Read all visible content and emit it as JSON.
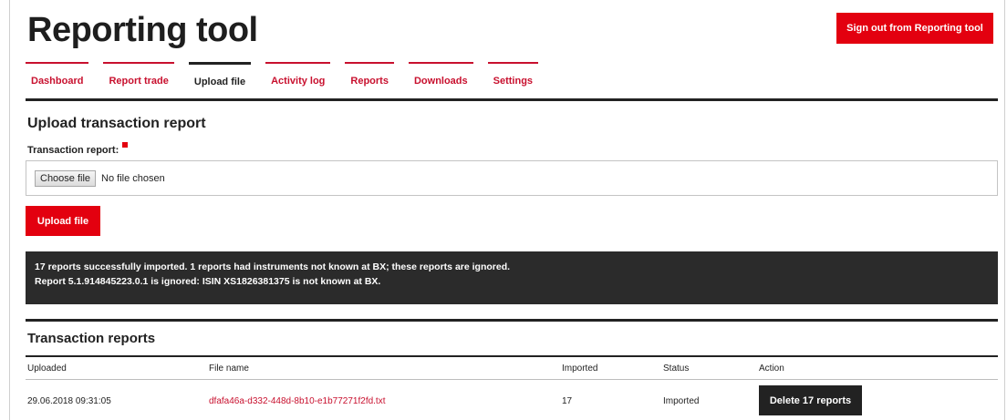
{
  "header": {
    "title": "Reporting tool",
    "signout_label": "Sign out from Reporting tool"
  },
  "tabs": [
    {
      "label": "Dashboard",
      "active": false
    },
    {
      "label": "Report trade",
      "active": false
    },
    {
      "label": "Upload file",
      "active": true
    },
    {
      "label": "Activity log",
      "active": false
    },
    {
      "label": "Reports",
      "active": false
    },
    {
      "label": "Downloads",
      "active": false
    },
    {
      "label": "Settings",
      "active": false
    }
  ],
  "upload": {
    "heading": "Upload transaction report",
    "field_label": "Transaction report:",
    "choose_label": "Choose file",
    "file_status": "No file chosen",
    "button_label": "Upload file"
  },
  "message": {
    "line1": "17 reports successfully imported. 1 reports had instruments not known at BX; these reports are ignored.",
    "line2": "Report 5.1.914845223.0.1 is ignored: ISIN XS1826381375 is not known at BX."
  },
  "reports": {
    "heading": "Transaction reports",
    "columns": [
      "Uploaded",
      "File name",
      "Imported",
      "Status",
      "Action"
    ],
    "rows": [
      {
        "uploaded": "29.06.2018 09:31:05",
        "file_name": "dfafa46a-d332-448d-8b10-e1b77271f2fd.txt",
        "imported": "17",
        "status": "Imported",
        "action": "Delete 17 reports"
      }
    ]
  },
  "colors": {
    "accent": "#e3000f",
    "tab_link": "#c8102e",
    "dark": "#222222",
    "message_bg": "#2b2b2b"
  }
}
